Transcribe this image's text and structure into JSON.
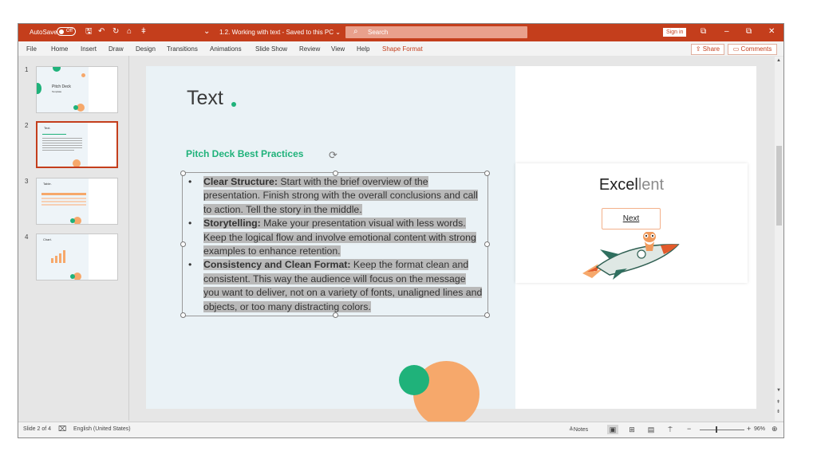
{
  "titlebar": {
    "autosave_label": "AutoSave",
    "autosave_state": "Off",
    "doc_title": "1.2. Working with text - Saved to this PC",
    "doc_title_caret": "⌄",
    "search_placeholder": "Search",
    "signin_label": "Sign in",
    "ribbon_display_icon": "⧉",
    "minimize_icon": "–",
    "restore_icon": "⧉",
    "close_icon": "✕",
    "qat": {
      "save": "🖫",
      "undo": "↶",
      "redo": "↻",
      "more1": "⌂",
      "more2": "ǂ",
      "customize": "⌄"
    }
  },
  "ribbon": {
    "tabs": [
      "File",
      "Home",
      "Insert",
      "Draw",
      "Design",
      "Transitions",
      "Animations",
      "Slide Show",
      "Review",
      "View",
      "Help",
      "Shape Format"
    ],
    "share_label": "Share",
    "comments_label": "Comments"
  },
  "thumbnails": [
    {
      "number": "1",
      "title": "Pitch Deck",
      "subtitle": "Template"
    },
    {
      "number": "2",
      "title": "Text."
    },
    {
      "number": "3",
      "title": "Table."
    },
    {
      "number": "4",
      "title": "Chart."
    }
  ],
  "slide": {
    "title": "Text",
    "subtitle": "Pitch Deck Best Practices",
    "bullets": [
      {
        "bold": "Clear Structure:",
        "text": " Start with the brief overview of the presentation. Finish strong with the overall conclusions and call to action. Tell the story in the middle."
      },
      {
        "bold": "Storytelling:",
        "text": " Make your presentation visual with less words. Keep the logical flow and involve emotional content with strong examples to enhance retention."
      },
      {
        "bold": "Consistency and Clean Format:",
        "text": " Keep the format clean and consistent. This way the audience will focus on the message you want to deliver, not on a variety of fonts, unaligned lines and objects, or too many distracting colors."
      }
    ],
    "card": {
      "heading_part1": "Excel",
      "heading_part2": "lent",
      "next_label": "Next"
    }
  },
  "statusbar": {
    "slide_info": "Slide 2 of 4",
    "language": "English (United States)",
    "notes_label": "Notes",
    "zoom_minus": "−",
    "zoom_plus": "+",
    "zoom_level": "96%"
  },
  "colors": {
    "accent": "#c43e1c",
    "green": "#1fb27a",
    "orange": "#f6a86b"
  }
}
